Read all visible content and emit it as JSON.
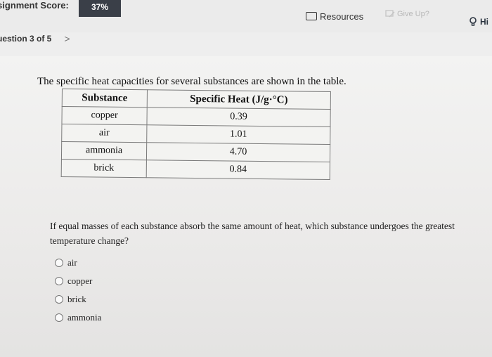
{
  "header": {
    "score_label": "signment Score:",
    "score_value": "37%",
    "resources_label": "Resources",
    "giveup_label": "Give Up?",
    "hint_label": "Hi"
  },
  "nav": {
    "question_label": "uestion 3 of 5",
    "next_glyph": ">"
  },
  "content": {
    "intro": "The specific heat capacities for several substances are shown in the table.",
    "table": {
      "headers": [
        "Substance",
        "Specific Heat (J/g·°C)"
      ],
      "rows": [
        [
          "copper",
          "0.39"
        ],
        [
          "air",
          "1.01"
        ],
        [
          "ammonia",
          "4.70"
        ],
        [
          "brick",
          "0.84"
        ]
      ]
    },
    "question": "If equal masses of each substance absorb the same amount of heat, which substance undergoes the greatest temperature change?",
    "options": [
      "air",
      "copper",
      "brick",
      "ammonia"
    ]
  }
}
